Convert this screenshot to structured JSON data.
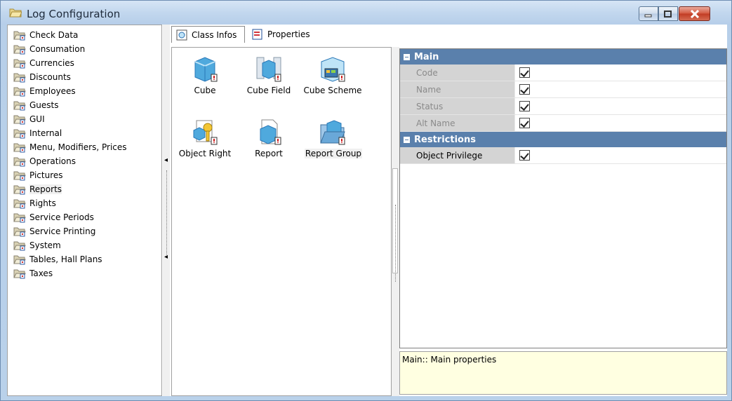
{
  "window": {
    "title": "Log Configuration",
    "controls": {
      "minimize": "minimize",
      "maximize": "maximize",
      "close": "close"
    }
  },
  "tree": {
    "items": [
      {
        "label": "Check Data"
      },
      {
        "label": "Consumation"
      },
      {
        "label": "Currencies"
      },
      {
        "label": "Discounts"
      },
      {
        "label": "Employees"
      },
      {
        "label": "Guests"
      },
      {
        "label": "GUI"
      },
      {
        "label": "Internal"
      },
      {
        "label": "Menu, Modifiers, Prices"
      },
      {
        "label": "Operations"
      },
      {
        "label": "Pictures"
      },
      {
        "label": "Reports",
        "selected": true
      },
      {
        "label": "Rights"
      },
      {
        "label": "Service Periods"
      },
      {
        "label": "Service Printing"
      },
      {
        "label": "System"
      },
      {
        "label": "Tables, Hall Plans"
      },
      {
        "label": "Taxes"
      }
    ]
  },
  "tabs": [
    {
      "label": "Class Infos",
      "active": true
    },
    {
      "label": "Properties",
      "active": false
    }
  ],
  "classes": [
    {
      "label": "Cube",
      "icon": "cube-icon"
    },
    {
      "label": "Cube Field",
      "icon": "cube-field-icon"
    },
    {
      "label": "Cube Scheme",
      "icon": "cube-scheme-icon"
    },
    {
      "label": "Object Right",
      "icon": "object-right-icon"
    },
    {
      "label": "Report",
      "icon": "report-icon"
    },
    {
      "label": "Report Group",
      "icon": "report-group-icon",
      "selected": true
    }
  ],
  "propgrid": {
    "categories": [
      {
        "title": "Main",
        "rows": [
          {
            "name": "Code",
            "checked": true,
            "enabled": false
          },
          {
            "name": "Name",
            "checked": true,
            "enabled": false
          },
          {
            "name": "Status",
            "checked": true,
            "enabled": false
          },
          {
            "name": "Alt Name",
            "checked": true,
            "enabled": false
          }
        ]
      },
      {
        "title": "Restrictions",
        "rows": [
          {
            "name": "Object Privilege",
            "checked": true,
            "enabled": true
          }
        ]
      }
    ]
  },
  "help": {
    "text": "Main:: Main properties"
  },
  "colors": {
    "category_header": "#5a80ac",
    "help_background": "#ffffe1",
    "close_button": "#c13b23"
  }
}
